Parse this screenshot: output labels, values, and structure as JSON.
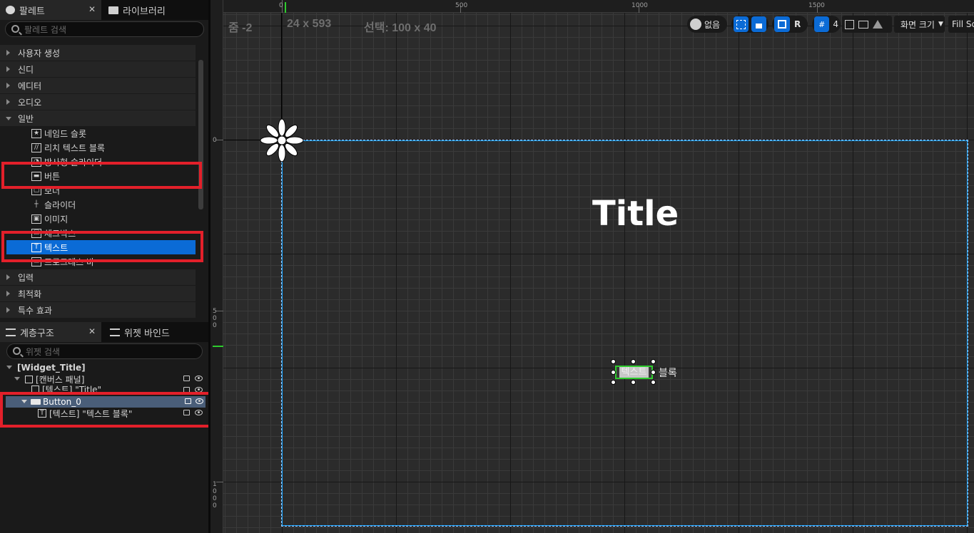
{
  "left_panel": {
    "tabs": [
      {
        "label": "팔레트",
        "close": "✕"
      },
      {
        "label": "라이브러리"
      }
    ],
    "palette_search_placeholder": "팔레트 검색",
    "categories_top": [
      {
        "label": "사용자 생성"
      },
      {
        "label": "신디"
      },
      {
        "label": "에디터"
      },
      {
        "label": "오디오"
      },
      {
        "label": "일반"
      }
    ],
    "general_items": [
      {
        "label": "네임드 슬롯",
        "icon": "★"
      },
      {
        "label": "리치 텍스트 블록",
        "icon": "//"
      },
      {
        "label": "방사형 슬라이더",
        "icon": "◔"
      },
      {
        "label": "버튼",
        "icon": "▬"
      },
      {
        "label": "보더",
        "icon": "▢"
      },
      {
        "label": "슬라이더",
        "icon": "┼"
      },
      {
        "label": "이미지",
        "icon": "▣"
      },
      {
        "label": "체크박스",
        "icon": "☑"
      },
      {
        "label": "텍스트",
        "icon": "T"
      },
      {
        "label": "프로그레스 바",
        "icon": "▭"
      }
    ],
    "categories_bottom": [
      {
        "label": "입력"
      },
      {
        "label": "최적화"
      },
      {
        "label": "특수 효과"
      }
    ],
    "hierarchy_tabs": [
      {
        "label": "계층구조",
        "close": "✕"
      },
      {
        "label": "위젯 바인드"
      }
    ],
    "widget_search_placeholder": "위젯 검색",
    "hierarchy": [
      {
        "label": "[Widget_Title]"
      },
      {
        "label": "[캔버스 패널]"
      },
      {
        "label": "[텍스트] \"Title\""
      },
      {
        "label": "Button_0"
      },
      {
        "label": "[텍스트] \"텍스트 블록\""
      }
    ]
  },
  "viewport": {
    "zoom": "줌 -2",
    "size": "24 x 593",
    "selection": "선택: 100 x 40",
    "ruler_top": [
      "0",
      "500",
      "1000",
      "1500"
    ],
    "ruler_left": [
      "0",
      "500",
      "1000"
    ],
    "toolbar": {
      "localization_label": "없음",
      "r_label": "R",
      "grid_value": "4",
      "screen_size_label": "화면 크기",
      "fill_label": "Fill Sc"
    },
    "canvas_title": "Title",
    "button_text_visible": "텍스트",
    "button_text_overflow": "블록"
  },
  "colors": {
    "accent": "#0b6bd6",
    "highlight_box": "#e3202a",
    "selection_outline": "#2ecc2e",
    "canvas_border": "#1ea7ff"
  }
}
